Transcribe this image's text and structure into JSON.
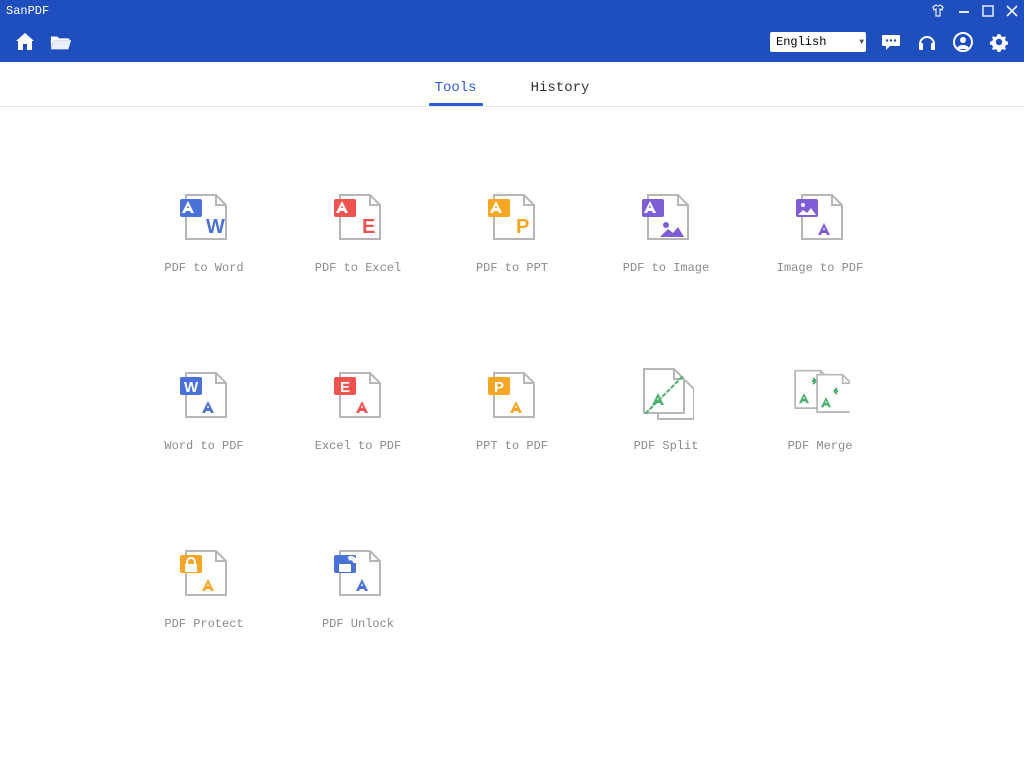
{
  "app": {
    "title": "SanPDF"
  },
  "toolbar": {
    "language": "English"
  },
  "tabs": {
    "tools": "Tools",
    "history": "History"
  },
  "tools": {
    "pdf_to_word": "PDF to Word",
    "pdf_to_excel": "PDF to Excel",
    "pdf_to_ppt": "PDF to PPT",
    "pdf_to_image": "PDF to Image",
    "image_to_pdf": "Image to PDF",
    "word_to_pdf": "Word to PDF",
    "excel_to_pdf": "Excel to PDF",
    "ppt_to_pdf": "PPT to PDF",
    "pdf_split": "PDF Split",
    "pdf_merge": "PDF Merge",
    "pdf_protect": "PDF Protect",
    "pdf_unlock": "PDF Unlock"
  },
  "colors": {
    "primary": "#1f4fbf",
    "stroke": "#b6b6b6",
    "blue": "#4a72d6",
    "red": "#ef5350",
    "orange": "#f5a623",
    "purple": "#7e5dd6",
    "green": "#4db06e"
  }
}
